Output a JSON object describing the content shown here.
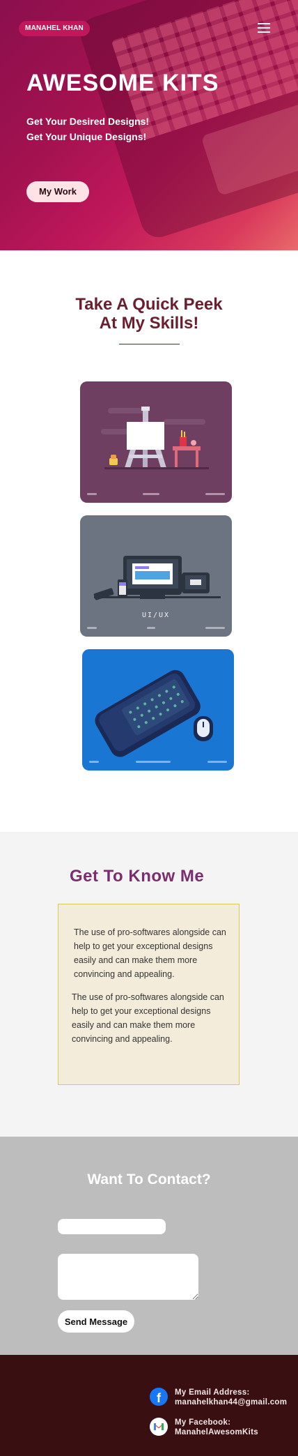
{
  "header": {
    "brand": "MANAHEL KHAN",
    "menu_icon": "hamburger-menu-icon"
  },
  "hero": {
    "title": "AWESOME KITS",
    "subtitle_1": "Get Your Desired Designs!",
    "subtitle_2": "Get Your Unique Designs!",
    "button": "My Work"
  },
  "skills": {
    "title_line_1": "Take A Quick Peek",
    "title_line_2": "At My Skills!",
    "cards": [
      {
        "name": "illustration",
        "label": ""
      },
      {
        "name": "ui-ux",
        "label": "UI/UX"
      },
      {
        "name": "3d-design",
        "label": ""
      }
    ]
  },
  "about": {
    "title": "Get To Know Me",
    "paragraph_1": "The use of pro-softwares alongside can help to get your exceptional designs easily and can make them more convincing and appealing.",
    "paragraph_2": "The use of pro-softwares alongside can help to get your exceptional designs easily and can make them more convincing and appealing."
  },
  "contact": {
    "title": "Want To Contact?",
    "name_value": "",
    "message_value": "",
    "send_button": "Send Message"
  },
  "footer": {
    "email_label": "My Email Address:",
    "email_value": "manahelkhan44@gmail.com",
    "facebook_label": "My Facebook:",
    "facebook_value": "ManahelAwesomKits",
    "icons": [
      "facebook-icon",
      "gmail-icon"
    ]
  },
  "colors": {
    "hero": "#a3124f",
    "brand_pill": "#c2185b",
    "skills_heading": "#6b1f2e",
    "about_heading": "#7b2d6e",
    "about_box": "#f3ecda",
    "contact_bg": "#bdbdbd",
    "footer_bg": "#3a0f12"
  }
}
